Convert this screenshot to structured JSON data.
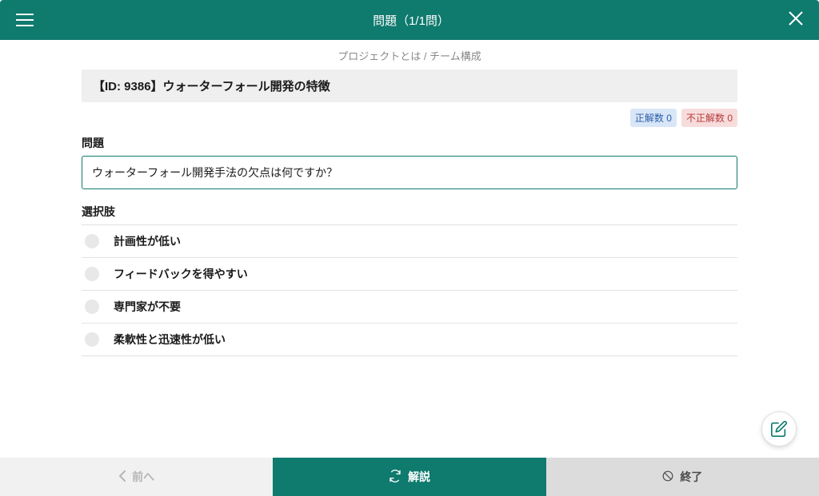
{
  "header": {
    "title": "問題（1/1問）"
  },
  "breadcrumb": "プロジェクトとは / チーム構成",
  "question": {
    "title": "【ID: 9386】ウォーターフォール開発の特徴",
    "section_label_q": "問題",
    "text": "ウォーターフォール開発手法の欠点は何ですか？",
    "section_label_choices": "選択肢",
    "choices": [
      "計画性が低い",
      "フィードバックを得やすい",
      "専門家が不要",
      "柔軟性と迅速性が低い"
    ]
  },
  "badges": {
    "correct_label": "正解数",
    "correct_count": "0",
    "incorrect_label": "不正解数",
    "incorrect_count": "0"
  },
  "footer": {
    "prev": "前へ",
    "explain": "解説",
    "finish": "終了"
  }
}
